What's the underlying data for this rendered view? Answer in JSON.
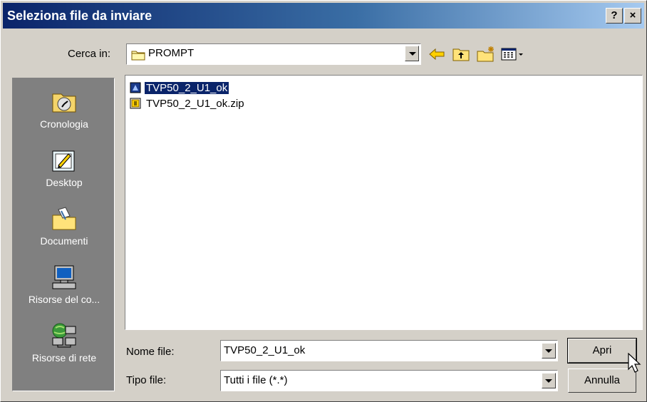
{
  "title": "Seleziona file da inviare",
  "titlebar": {
    "help_label": "?",
    "close_label": "×"
  },
  "lookin": {
    "label": "Cerca in:",
    "value": "PROMPT"
  },
  "toolbar": {
    "back_icon": "back-arrow-icon",
    "up_icon": "up-folder-icon",
    "new_folder_icon": "new-folder-icon",
    "view_icon": "view-menu-icon"
  },
  "places": [
    {
      "label": "Cronologia",
      "icon": "history-icon"
    },
    {
      "label": "Desktop",
      "icon": "desktop-icon"
    },
    {
      "label": "Documenti",
      "icon": "documents-folder-icon"
    },
    {
      "label": "Risorse del co...",
      "icon": "my-computer-icon"
    },
    {
      "label": "Risorse di rete",
      "icon": "network-icon"
    }
  ],
  "files": [
    {
      "name": "TVP50_2_U1_ok",
      "selected": true
    },
    {
      "name": "TVP50_2_U1_ok.zip",
      "selected": false
    }
  ],
  "filename": {
    "label": "Nome file:",
    "value": "TVP50_2_U1_ok"
  },
  "filetype": {
    "label": "Tipo file:",
    "value": "Tutti i file (*.*)"
  },
  "buttons": {
    "open": "Apri",
    "cancel": "Annulla"
  },
  "colors": {
    "title_start": "#0a246a",
    "title_end": "#a6caf0",
    "selection": "#0a246a",
    "places_bg": "#808080",
    "dialog_bg": "#d4d0c8"
  }
}
